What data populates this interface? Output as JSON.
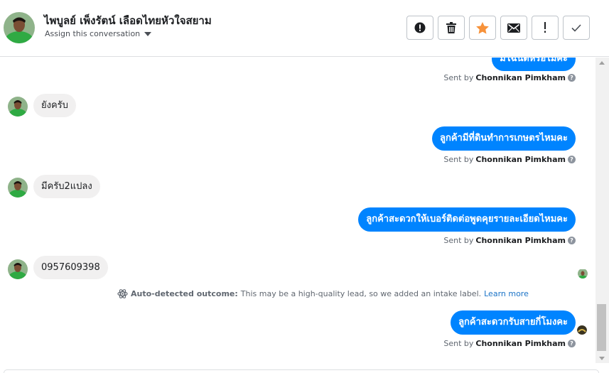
{
  "header": {
    "contact_name": "ไพบูลย์ เพ็งรัตน์ เลือดไทยหัวใจสยาม",
    "assign_label": "Assign this conversation",
    "actions": [
      {
        "name": "spam-button",
        "icon": "alert-circle-icon"
      },
      {
        "name": "delete-button",
        "icon": "trash-icon"
      },
      {
        "name": "star-button",
        "icon": "star-icon"
      },
      {
        "name": "mark-unread-button",
        "icon": "envelope-icon"
      },
      {
        "name": "follow-up-button",
        "icon": "exclamation-icon"
      },
      {
        "name": "mark-done-button",
        "icon": "check-icon"
      }
    ]
  },
  "thread": {
    "messages": [
      {
        "direction": "out",
        "text": "มีโฉนดหรือไม่คะ",
        "partial": true
      },
      {
        "direction": "meta",
        "text_prefix": "Sent by",
        "sender": "Chonnikan Pimkham"
      },
      {
        "direction": "in",
        "text": "ยังครับ"
      },
      {
        "direction": "out",
        "text": "ลูกค้ามีที่ดินทำการเกษตรไหมคะ"
      },
      {
        "direction": "meta",
        "text_prefix": "Sent by",
        "sender": "Chonnikan Pimkham"
      },
      {
        "direction": "in",
        "text": "มีครับ2แปลง"
      },
      {
        "direction": "out",
        "text": "ลูกค้าสะดวกให้เบอร์ติดต่อพูดคุยรายละเอียดไหมคะ"
      },
      {
        "direction": "meta",
        "text_prefix": "Sent by",
        "sender": "Chonnikan Pimkham"
      },
      {
        "direction": "in",
        "text": "0957609398"
      },
      {
        "direction": "out",
        "text": "ลูกค้าสะดวกรับสายกี่โมงคะ"
      },
      {
        "direction": "meta",
        "text_prefix": "Sent by",
        "sender": "Chonnikan Pimkham"
      }
    ],
    "outcome": {
      "label": "Auto-detected outcome:",
      "text": "This may be a high-quality lead, so we added an intake label.",
      "link": "Learn more"
    }
  },
  "colors": {
    "outgoing_bubble": "#0084ff",
    "incoming_bubble": "#f1f0f0",
    "star": "#f7923a",
    "link": "#1a73c7"
  }
}
